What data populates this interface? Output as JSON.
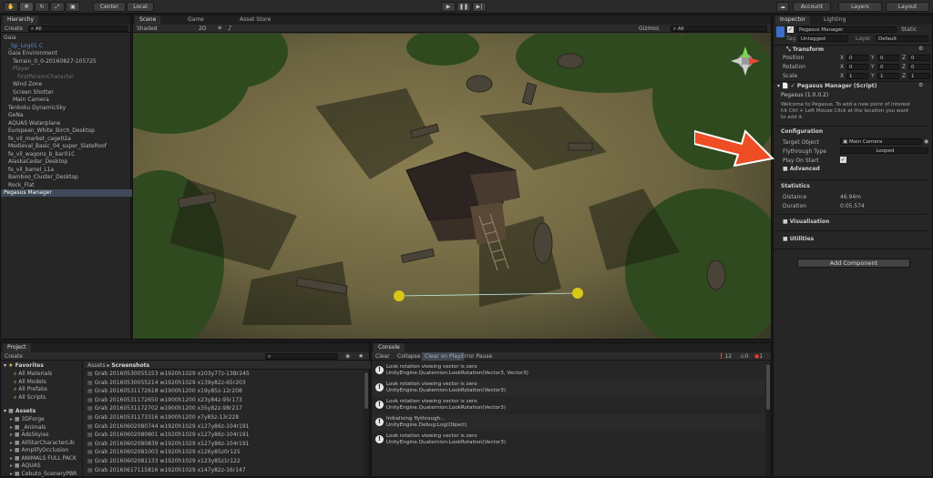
{
  "toolbar": {
    "pivot": "Center",
    "space": "Local",
    "account": "Account",
    "layers": "Layers",
    "layout": "Layout"
  },
  "hierarchy": {
    "tab": "Hierarchy",
    "create": "Create",
    "items": [
      {
        "label": "Gaia",
        "cls": "",
        "indent": 0
      },
      {
        "label": "_Sp_Log01 C",
        "cls": "blue",
        "indent": 1
      },
      {
        "label": "Gaia Environment",
        "cls": "",
        "indent": 1
      },
      {
        "label": "Terrain_0_0-20160827-105725",
        "cls": "",
        "indent": 2
      },
      {
        "label": "Player",
        "cls": "dim",
        "indent": 2
      },
      {
        "label": "FirstPersonCharacter",
        "cls": "dim",
        "indent": 3
      },
      {
        "label": "Wind Zone",
        "cls": "",
        "indent": 2
      },
      {
        "label": "Screen Shotter",
        "cls": "",
        "indent": 2
      },
      {
        "label": "Main Camera",
        "cls": "",
        "indent": 2
      },
      {
        "label": "Tenkoku DynamicSky",
        "cls": "",
        "indent": 1
      },
      {
        "label": "GeNa",
        "cls": "",
        "indent": 1
      },
      {
        "label": "AQUAS Waterplane",
        "cls": "",
        "indent": 1
      },
      {
        "label": "European_White_Birch_Desktop",
        "cls": "",
        "indent": 1
      },
      {
        "label": "fe_vil_market_cage02a",
        "cls": "",
        "indent": 1
      },
      {
        "label": "Medieval_Basic_04_super_SlateRoof",
        "cls": "",
        "indent": 1
      },
      {
        "label": "fe_vil_wagons_b_bar01C",
        "cls": "",
        "indent": 1
      },
      {
        "label": "AlaskaCedar_Desktop",
        "cls": "",
        "indent": 1
      },
      {
        "label": "fe_vil_barrel_L1a",
        "cls": "",
        "indent": 1
      },
      {
        "label": "Bamboo_Cluster_Desktop",
        "cls": "",
        "indent": 1
      },
      {
        "label": "Rock_Flat",
        "cls": "",
        "indent": 1
      },
      {
        "label": "Pegasus Manager",
        "cls": "sel",
        "indent": 0
      }
    ]
  },
  "scene": {
    "tab_scene": "Scene",
    "tab_game": "Game",
    "tab_store": "Asset Store",
    "shaded": "Shaded",
    "mode": "2D",
    "gizmos": "Gizmos"
  },
  "inspector": {
    "tab": "Inspector",
    "tab2": "Lighting",
    "object_name": "Pegasus Manager",
    "static": "Static",
    "tag_label": "Tag",
    "tag": "Untagged",
    "layer_label": "Layer",
    "layer": "Default",
    "transform": "Transform",
    "position": "Position",
    "rotation": "Rotation",
    "scale": "Scale",
    "pos": [
      "0",
      "0",
      "0"
    ],
    "rot": [
      "0",
      "0",
      "0"
    ],
    "scl": [
      "1",
      "1",
      "1"
    ],
    "script_title": "Pegasus Manager (Script)",
    "version": "Pegasus (1.0.0.2)",
    "welcome": [
      "Welcome to Pegasus. To add a new point of interest",
      "hit Ctrl + Left Mouse Click at the location you want",
      "to add it."
    ],
    "config": "Configuration",
    "target_label": "Target Object",
    "target": "Main Camera",
    "fly_label": "Flythrough Type",
    "fly": "Looped",
    "play_label": "Play On Start",
    "advanced": "Advanced",
    "stats": "Statistics",
    "distance_label": "Distance",
    "distance": "46.94m",
    "duration_label": "Duration",
    "duration": "0:05.574",
    "visualisation": "Visualisation",
    "utilities": "Utilities",
    "add_component": "Add Component"
  },
  "project": {
    "tab": "Project",
    "create": "Create",
    "favorites": "Favorites",
    "fav_items": [
      "All Materials",
      "All Models",
      "All Prefabs",
      "All Scripts"
    ],
    "assets": "Assets",
    "asset_items": [
      "3DForge",
      "_Animals",
      "AdsSkyies",
      "AllStarCharacterLib",
      "AmplifyOcclusion",
      "ANIMALS FULL PACK",
      "AQUAS",
      "Cebuto_SceneryPBR"
    ],
    "breadcrumb_root": "Assets",
    "breadcrumb_leaf": "Screenshots",
    "files": [
      "Grab 20160530055153 w1920h1029 x103y77z-13Br245",
      "Grab 20160530055214 w1920h1029 x139y82z-65r203",
      "Grab 20160531172618 w1900h1200 x19y85z-12r208",
      "Grab 20160531172650 w1900h1200 x23y84z-95r173",
      "Grab 20160531172702 w1900h1200 x35y82z-98r217",
      "Grab 20160531173316 w1900h1200 x7y85z-13r228",
      "Grab 20160602080744 w1920h1029 x127y86z-104r191",
      "Grab 20160602080801 w1920h1029 x127y86z-104r191",
      "Grab 20160602080839 w1920h1029 x127y86z-104r191",
      "Grab 20160602081003 w1920h1029 x126y85z0r125",
      "Grab 20160602081133 w1920h1029 x123y85z1r122",
      "Grab 20160617115816 w1920h1029 x147y82z-16r147"
    ]
  },
  "console": {
    "tab": "Console",
    "clear": "Clear",
    "collapse": "Collapse",
    "clear_on_play": "Clear on Play",
    "error_pause": "Error Pause",
    "warn_count": "12",
    "info_count": "0",
    "err_count": "1",
    "messages": [
      [
        "Look rotation viewing vector is zero",
        "UnityEngine.Quaternion:LookRotation(Vector3, Vector3)"
      ],
      [
        "Look rotation viewing vector is zero",
        "UnityEngine.Quaternion:LookRotation(Vector3)"
      ],
      [
        "Look rotation viewing vector is zero",
        "UnityEngine.Quaternion:LookRotation(Vector3)"
      ],
      [
        "Initialising flythrough...",
        "UnityEngine.Debug:Log(Object)"
      ],
      [
        "Look rotation viewing vector is zero",
        "UnityEngine.Quaternion:LookRotation(Vector3)"
      ]
    ]
  },
  "colors": {
    "accent": "#ef4d23",
    "selection": "#3e4a5a",
    "terrain": "#6b6440"
  }
}
